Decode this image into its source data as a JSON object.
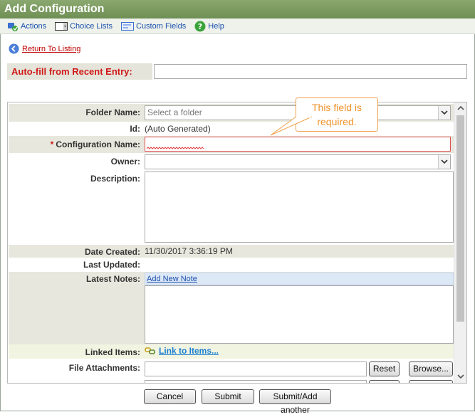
{
  "window": {
    "title": "Add Configuration"
  },
  "menu": {
    "actions": "Actions",
    "choice_lists": "Choice Lists",
    "custom_fields": "Custom Fields",
    "help": "Help"
  },
  "nav": {
    "return_label": "Return To Listing"
  },
  "autofill": {
    "label": "Auto-fill from Recent Entry:",
    "value": ""
  },
  "form": {
    "folder": {
      "label": "Folder Name:",
      "placeholder": "Select a folder"
    },
    "id": {
      "label": "Id:",
      "value": "(Auto Generated)"
    },
    "config_name": {
      "required_mark": "*",
      "label": "Configuration Name:",
      "value": ""
    },
    "owner": {
      "label": "Owner:",
      "value": ""
    },
    "description": {
      "label": "Description:",
      "value": ""
    },
    "date_created": {
      "label": "Date Created:",
      "value": "11/30/2017 3:36:19 PM"
    },
    "last_updated": {
      "label": "Last Updated:",
      "value": ""
    },
    "latest_notes": {
      "label": "Latest Notes:",
      "add_link": "Add New Note"
    },
    "linked_items": {
      "label": "Linked Items:",
      "link": "Link to Items..."
    },
    "file_attachments": {
      "label": "File Attachments:",
      "reset": "Reset",
      "browse": "Browse..."
    }
  },
  "validation": {
    "tooltip": "This field is required."
  },
  "footer": {
    "cancel": "Cancel",
    "submit": "Submit",
    "submit_another": "Submit/Add another"
  },
  "colors": {
    "title_bar": "#7a9a60",
    "required": "#d01818",
    "link": "#1b4fb0",
    "tooltip": "#f0922a"
  }
}
